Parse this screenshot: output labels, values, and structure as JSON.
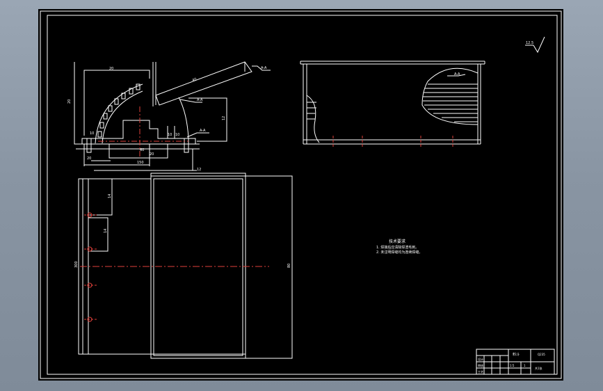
{
  "drawing": {
    "roughness_mark": "12.5",
    "dim_labels": {
      "d_top_20": "20",
      "d_left_20": "20",
      "d_chute_40": "40",
      "d_12": "12",
      "d_10a": "10",
      "d_10b": "10",
      "d_right_10": "10",
      "d_20_low": "20",
      "d_60": "60",
      "d_20_base": "20",
      "d_150": "150",
      "d_12b": "12",
      "d_14a": "14",
      "d_14b": "14",
      "d_300": "300",
      "d_plan_right": "80"
    },
    "leaders": {
      "l1": "A-A",
      "l2": "A-A",
      "l3": "A-A",
      "l4": "A-A"
    },
    "notes": {
      "title": "技术要求",
      "line1": "1. 焊接后应清除焊渣毛刺。",
      "line2": "2. 未注明焊缝均为连续焊缝。"
    },
    "title_block": {
      "name": "料斗",
      "scale": "1:5",
      "material": "Q235",
      "qty": "1",
      "r1": "设计",
      "r2": "审核",
      "r3": "工艺",
      "sheet": "共1张"
    }
  }
}
